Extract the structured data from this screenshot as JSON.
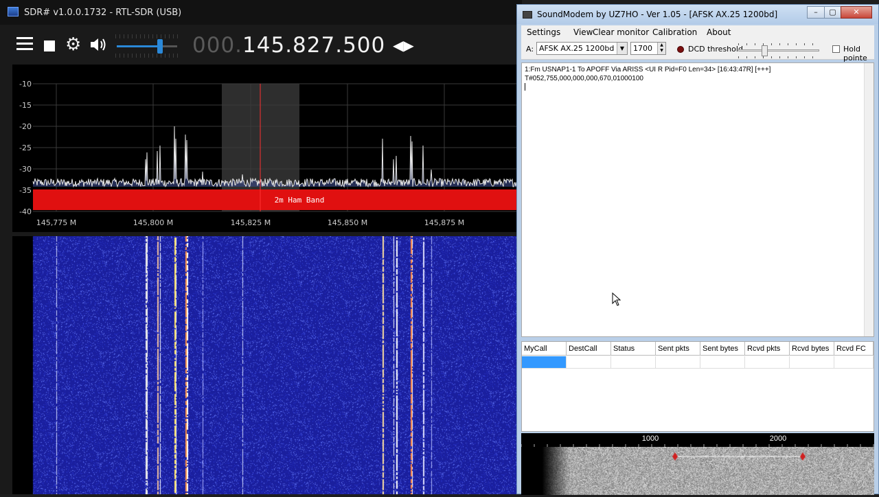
{
  "sdr": {
    "title": "SDR# v1.0.0.1732 - RTL-SDR (USB)",
    "frequency_prefix": "000.",
    "frequency_main": "145.827.500",
    "volume_fraction": 0.72,
    "band_label": "2m Ham Band",
    "db_ticks": [
      "-10",
      "-15",
      "-20",
      "-25",
      "-30",
      "-35",
      "-40"
    ],
    "freq_ticks": [
      "145,775 M",
      "145,800 M",
      "145,825 M",
      "145,850 M",
      "145,875 M"
    ],
    "colors": {
      "band": "#e01010",
      "waterfall_bg": "#1a1f9e",
      "accent": "#2a88d8"
    },
    "icons": {
      "menu": "hamburger-icon",
      "stop": "stop-icon",
      "settings": "gear-icon",
      "audio": "speaker-icon",
      "tune": "left-right-arrows-icon"
    }
  },
  "soundmodem": {
    "title": "SoundModem by UZ7HO - Ver 1.05 - [AFSK AX.25 1200bd]",
    "menu": [
      "Settings",
      "View",
      "Clear monitor",
      "Calibration",
      "About"
    ],
    "channel_label": "A:",
    "modem": "AFSK AX.25 1200bd",
    "center_freq": "1700",
    "dcd_label": "DCD threshold",
    "hold_label": "Hold pointe",
    "monitor_lines": [
      "1:Fm USNAP1-1 To APOFF Via ARISS <UI R Pid=F0 Len=34> [16:43:47R] [+++]",
      "T#052,755,000,000,000,670,01000100"
    ],
    "stats_columns": [
      "MyCall",
      "DestCall",
      "Status",
      "Sent pkts",
      "Sent bytes",
      "Rcvd pkts",
      "Rcvd bytes",
      "Rcvd FC"
    ],
    "scale_labels": [
      "1000",
      "2000"
    ]
  }
}
